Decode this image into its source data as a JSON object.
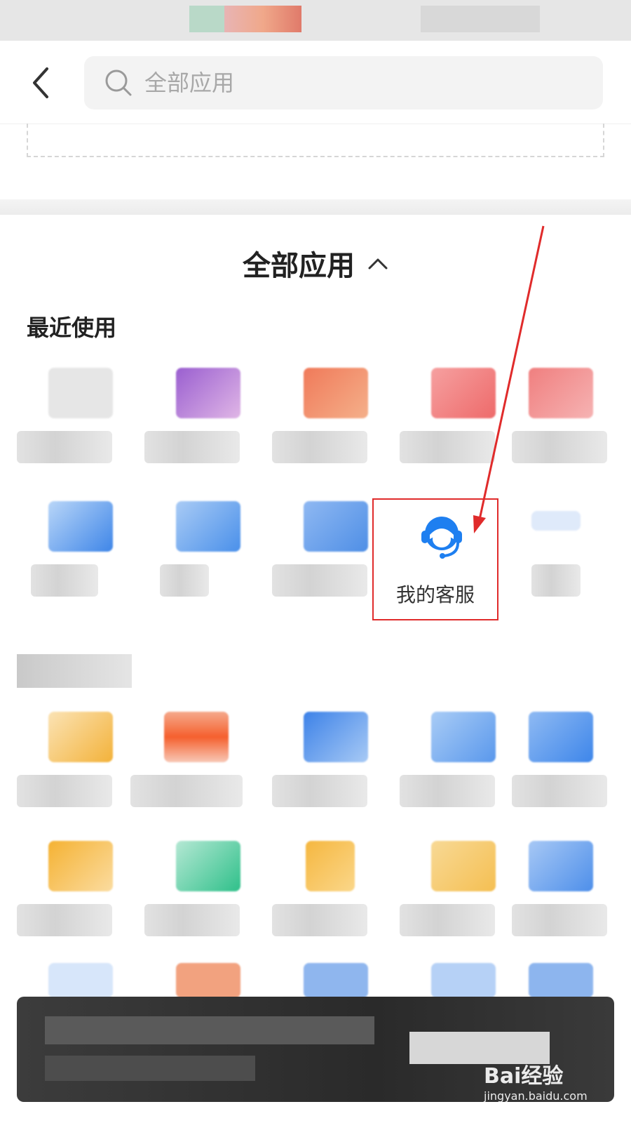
{
  "search": {
    "placeholder": "全部应用",
    "value": ""
  },
  "section": {
    "title": "全部应用"
  },
  "recent": {
    "label": "最近使用"
  },
  "service": {
    "label": "我的客服"
  },
  "watermark": {
    "main": "Bai经验",
    "sub": "jingyan.baidu.com"
  },
  "colors": {
    "accent": "#1e7ff0",
    "highlight_box": "#e02b2b",
    "annotation_arrow": "#e02b2b"
  },
  "icons": {
    "back": "chevron-left-icon",
    "search": "search-icon",
    "collapse": "chevron-up-icon",
    "service": "customer-service-headset-icon"
  },
  "tile_colors": {
    "row1": [
      "#e6e6e6",
      "#b586d6",
      "#f08a6a",
      "#ee7a7a",
      "#f29a9a"
    ],
    "row2": [
      "#8fb8f0",
      "#7fb0ee",
      "#7aaaf0",
      "",
      "#dbe9f8"
    ],
    "row3": [
      "#f6d79a",
      "#f5845f",
      "#6aa6f0",
      "#8ab8f0",
      "#7fb0f0"
    ],
    "row4": [
      "#f6c25c",
      "#4fc79a",
      "#f5bd4a",
      "#f6c767",
      "#7fb0f0"
    ]
  }
}
